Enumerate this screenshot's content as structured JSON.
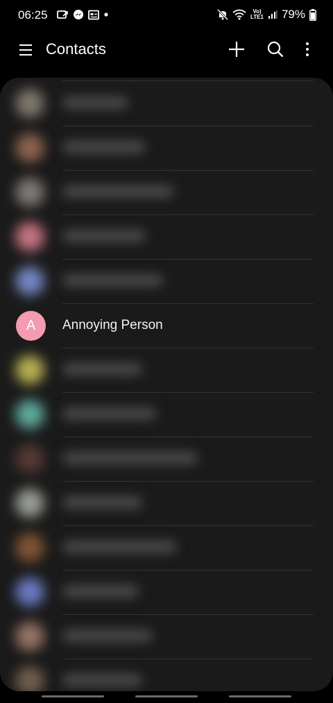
{
  "status_bar": {
    "time": "06:25",
    "battery": "79%",
    "left_icons": [
      "missed-call-icon",
      "messenger-icon",
      "calendar-icon",
      "dot-icon"
    ],
    "right_icons": [
      "mute-icon",
      "wifi-icon",
      "volte-icon",
      "signal-icon",
      "battery-icon"
    ],
    "volte_label_top": "Vo)",
    "volte_label_bottom": "LTE1"
  },
  "app_bar": {
    "title": "Contacts",
    "icons": [
      "menu-icon",
      "add-icon",
      "search-icon",
      "more-icon"
    ]
  },
  "contacts": {
    "focused": {
      "initial": "A",
      "name": "Annoying Person",
      "avatar_color": "#f39bb0"
    },
    "blurred_avatar_colors": [
      "#8a8377",
      "#9a6b55",
      "#8c8480",
      "#d97f8f",
      "#7f93d6",
      "#c9c05a",
      "#66b9a8",
      "#5b3d37",
      "#a7aba2",
      "#8b5a37",
      "#7384d4",
      "#a27e6d",
      "#7a6655"
    ]
  },
  "colors": {
    "background": "#000000",
    "card": "#1a1a1a",
    "divider": "#333333"
  }
}
